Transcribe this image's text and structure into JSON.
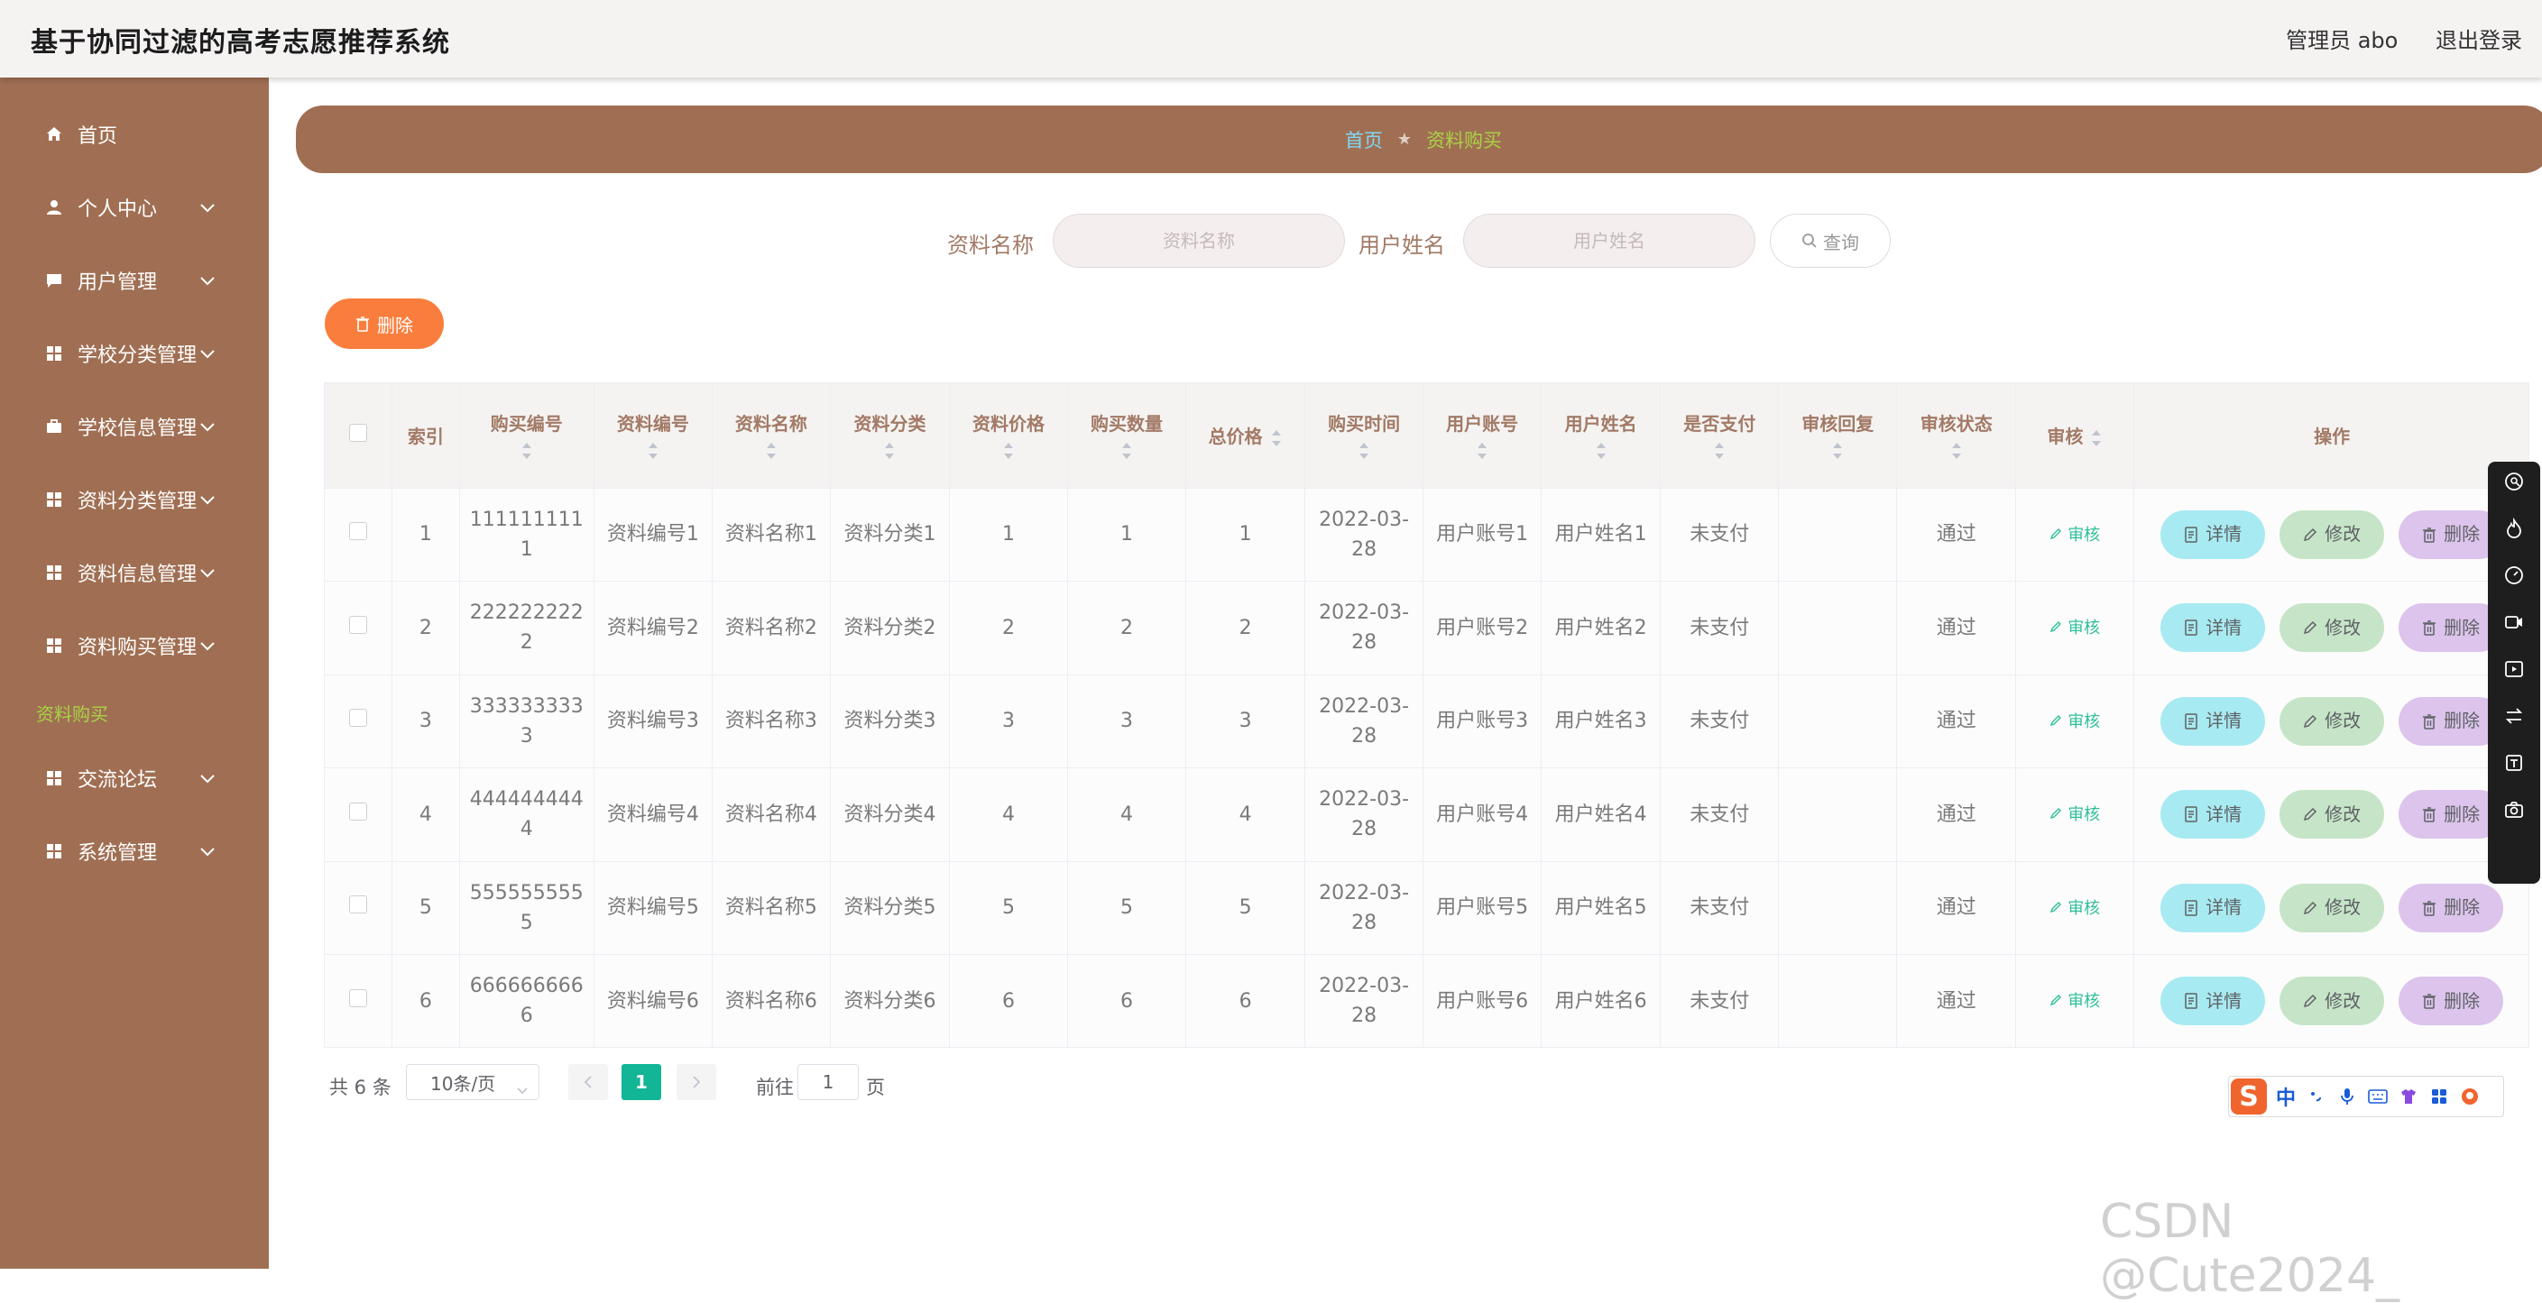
{
  "header": {
    "title": "基于协同过滤的高考志愿推荐系统",
    "user_text": "管理员 abo",
    "logout": "退出登录"
  },
  "sidebar": {
    "items": [
      {
        "label": "首页",
        "icon": "home-icon",
        "expandable": false
      },
      {
        "label": "个人中心",
        "icon": "person-icon",
        "expandable": true
      },
      {
        "label": "用户管理",
        "icon": "chat-icon",
        "expandable": true
      },
      {
        "label": "学校分类管理",
        "icon": "grid-icon",
        "expandable": true
      },
      {
        "label": "学校信息管理",
        "icon": "briefcase-icon",
        "expandable": true
      },
      {
        "label": "资料分类管理",
        "icon": "grid-icon",
        "expandable": true
      },
      {
        "label": "资料信息管理",
        "icon": "grid-icon",
        "expandable": true
      },
      {
        "label": "资料购买管理",
        "icon": "grid-icon",
        "expandable": true
      },
      {
        "label": "交流论坛",
        "icon": "grid-icon",
        "expandable": true
      },
      {
        "label": "系统管理",
        "icon": "grid-icon",
        "expandable": true
      }
    ],
    "active_sub": "资料购买"
  },
  "breadcrumb": {
    "home": "首页",
    "separator": "★",
    "current": "资料购买"
  },
  "search": {
    "name_label": "资料名称",
    "name_placeholder": "资料名称",
    "name_value": "",
    "user_label": "用户姓名",
    "user_placeholder": "用户姓名",
    "user_value": "",
    "query_button": "查询"
  },
  "actions": {
    "delete_button": "删除"
  },
  "table": {
    "headers": [
      "索引",
      "购买编号",
      "资料编号",
      "资料名称",
      "资料分类",
      "资料价格",
      "购买数量",
      "总价格",
      "购买时间",
      "用户账号",
      "用户姓名",
      "是否支付",
      "审核回复",
      "审核状态",
      "审核",
      "操作"
    ],
    "rows": [
      {
        "index": "1",
        "purchase_no_1": "111111111",
        "purchase_no_2": "1",
        "item_no": "资料编号1",
        "item_name": "资料名称1",
        "category": "资料分类1",
        "price": "1",
        "quantity": "1",
        "total": "1",
        "date_1": "2022-03-",
        "date_2": "28",
        "account": "用户账号1",
        "username": "用户姓名1",
        "paid": "未支付",
        "reply": "",
        "status": "通过",
        "audit": "审核"
      },
      {
        "index": "2",
        "purchase_no_1": "222222222",
        "purchase_no_2": "2",
        "item_no": "资料编号2",
        "item_name": "资料名称2",
        "category": "资料分类2",
        "price": "2",
        "quantity": "2",
        "total": "2",
        "date_1": "2022-03-",
        "date_2": "28",
        "account": "用户账号2",
        "username": "用户姓名2",
        "paid": "未支付",
        "reply": "",
        "status": "通过",
        "audit": "审核"
      },
      {
        "index": "3",
        "purchase_no_1": "333333333",
        "purchase_no_2": "3",
        "item_no": "资料编号3",
        "item_name": "资料名称3",
        "category": "资料分类3",
        "price": "3",
        "quantity": "3",
        "total": "3",
        "date_1": "2022-03-",
        "date_2": "28",
        "account": "用户账号3",
        "username": "用户姓名3",
        "paid": "未支付",
        "reply": "",
        "status": "通过",
        "audit": "审核"
      },
      {
        "index": "4",
        "purchase_no_1": "444444444",
        "purchase_no_2": "4",
        "item_no": "资料编号4",
        "item_name": "资料名称4",
        "category": "资料分类4",
        "price": "4",
        "quantity": "4",
        "total": "4",
        "date_1": "2022-03-",
        "date_2": "28",
        "account": "用户账号4",
        "username": "用户姓名4",
        "paid": "未支付",
        "reply": "",
        "status": "通过",
        "audit": "审核"
      },
      {
        "index": "5",
        "purchase_no_1": "555555555",
        "purchase_no_2": "5",
        "item_no": "资料编号5",
        "item_name": "资料名称5",
        "category": "资料分类5",
        "price": "5",
        "quantity": "5",
        "total": "5",
        "date_1": "2022-03-",
        "date_2": "28",
        "account": "用户账号5",
        "username": "用户姓名5",
        "paid": "未支付",
        "reply": "",
        "status": "通过",
        "audit": "审核"
      },
      {
        "index": "6",
        "purchase_no_1": "666666666",
        "purchase_no_2": "6",
        "item_no": "资料编号6",
        "item_name": "资料名称6",
        "category": "资料分类6",
        "price": "6",
        "quantity": "6",
        "total": "6",
        "date_1": "2022-03-",
        "date_2": "28",
        "account": "用户账号6",
        "username": "用户姓名6",
        "paid": "未支付",
        "reply": "",
        "status": "通过",
        "audit": "审核"
      }
    ],
    "row_buttons": {
      "detail": "详情",
      "edit": "修改",
      "delete": "删除"
    }
  },
  "pagination": {
    "total_text": "共 6 条",
    "page_size": "10条/页",
    "current_page": "1",
    "goto_label": "前往",
    "goto_value": "1",
    "page_suffix": "页"
  },
  "ime": {
    "logo": "S",
    "mode": "中"
  },
  "watermark": "CSDN @Cute2024_",
  "colors": {
    "sidebar": "#a06f53",
    "accent_orange": "#f97e3d",
    "pager_active": "#12b596",
    "detail_button": "#a8eaf1",
    "edit_button": "#c6e4c7",
    "delete_button": "#dcc4ec"
  }
}
